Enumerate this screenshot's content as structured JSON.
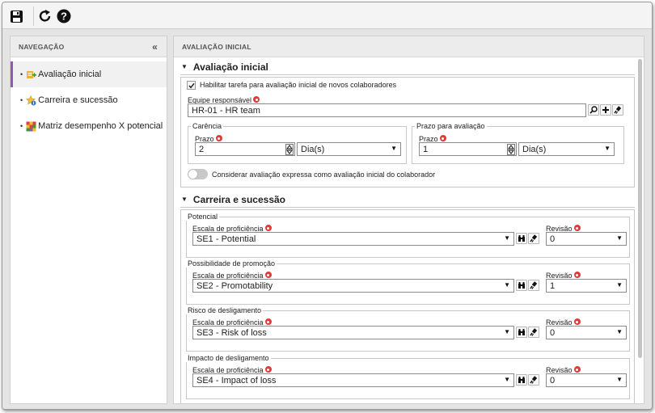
{
  "toolbar": {
    "save_icon": "save-icon",
    "refresh_icon": "refresh-icon",
    "help_icon": "help-icon"
  },
  "nav": {
    "header": "NAVEGAÇÃO",
    "collapse_glyph": "«",
    "items": [
      {
        "label": "Avaliação inicial",
        "icon": "initial-assessment-icon",
        "active": true
      },
      {
        "label": "Carreira e sucessão",
        "icon": "career-succession-icon",
        "active": false
      },
      {
        "label": "Matriz desempenho X potencial",
        "icon": "performance-matrix-icon",
        "active": false
      }
    ]
  },
  "main": {
    "header": "AVALIAÇÃO INICIAL",
    "section1": {
      "title": "Avaliação inicial",
      "enable_task_label": "Habilitar tarefa para avaliação inicial de novos colaboradores",
      "enable_task_checked": true,
      "team_label": "Equipe responsável",
      "team_value": "HR-01 - HR team",
      "grace": {
        "legend": "Carência",
        "term_label": "Prazo",
        "term_value": "2",
        "unit_value": "Dia(s)"
      },
      "deadline": {
        "legend": "Prazo para avaliação",
        "term_label": "Prazo",
        "term_value": "1",
        "unit_value": "Dia(s)"
      },
      "express_label": "Considerar avaliação expressa como avaliação inicial do colaborador",
      "express_enabled": false
    },
    "section2": {
      "title": "Carreira e sucessão",
      "groups": [
        {
          "legend": "Potencial",
          "scale_label": "Escala de proficiência",
          "scale_value": "SE1 - Potential",
          "revision_label": "Revisão",
          "revision_value": "0"
        },
        {
          "legend": "Possibilidade de promoção",
          "scale_label": "Escala de proficiência",
          "scale_value": "SE2 - Promotability",
          "revision_label": "Revisão",
          "revision_value": "1"
        },
        {
          "legend": "Risco de desligamento",
          "scale_label": "Escala de proficiência",
          "scale_value": "SE3 - Risk of loss",
          "revision_label": "Revisão",
          "revision_value": "0"
        },
        {
          "legend": "Impacto de desligamento",
          "scale_label": "Escala de proficiência",
          "scale_value": "SE4 - Impact of loss",
          "revision_label": "Revisão",
          "revision_value": "0"
        }
      ]
    }
  },
  "colors": {
    "active_accent": "#8e58b3",
    "required": "#e03a3a"
  }
}
